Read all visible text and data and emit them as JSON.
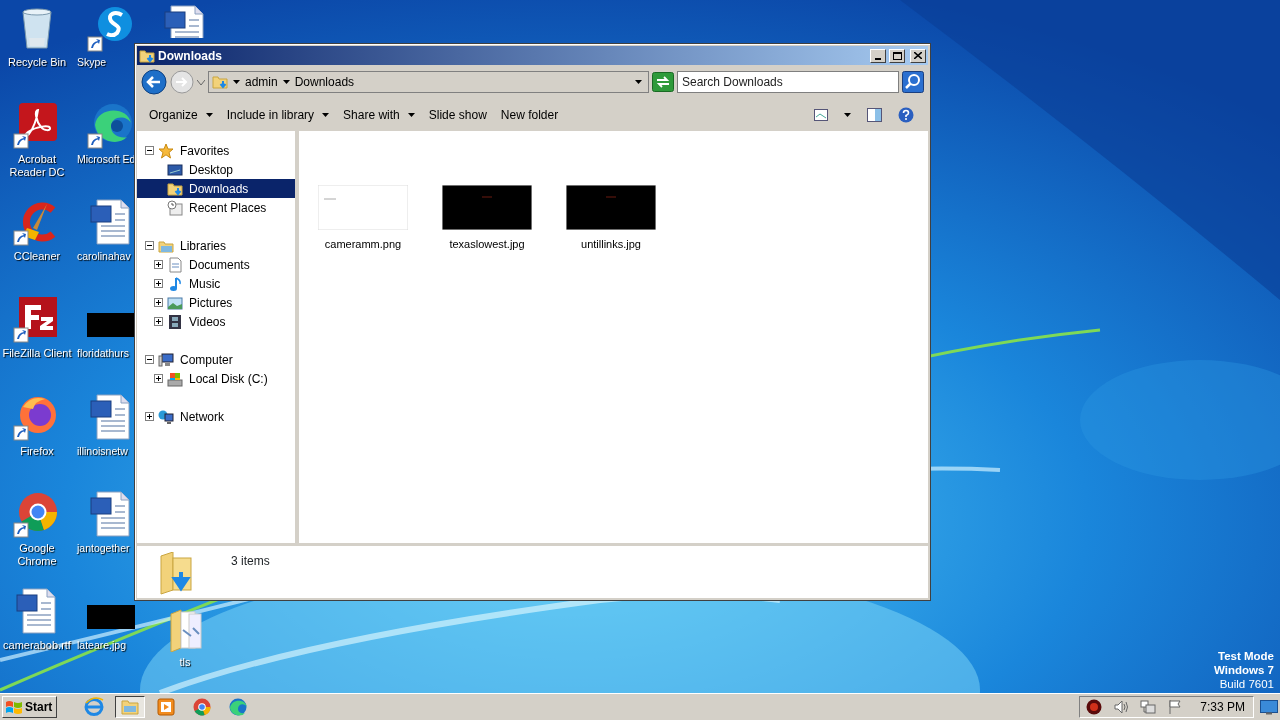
{
  "desktop": {
    "columns": [
      [
        {
          "label": "Recycle Bin",
          "kind": "recycle-bin"
        },
        {
          "label": "Acrobat Reader DC",
          "kind": "pdf-reader",
          "shortcut": true
        },
        {
          "label": "CCleaner",
          "kind": "cleaner",
          "shortcut": true
        },
        {
          "label": "FileZilla Client",
          "kind": "ftp-client",
          "shortcut": true
        },
        {
          "label": "Firefox",
          "kind": "firefox",
          "shortcut": true
        },
        {
          "label": "Google Chrome",
          "kind": "chrome",
          "shortcut": true
        },
        {
          "label": "camerabob.rtf",
          "kind": "word-document"
        }
      ],
      [
        {
          "label": "Skype",
          "kind": "messenger",
          "shortcut": true
        },
        {
          "label": "Microsoft Ed",
          "kind": "edge",
          "shortcut": true
        },
        {
          "label": "carolinahav",
          "kind": "word-document"
        },
        {
          "label": "floridathurs",
          "kind": "dark-image"
        },
        {
          "label": "illinoisnetw",
          "kind": "word-document"
        },
        {
          "label": "jantogether",
          "kind": "word-document"
        },
        {
          "label": "lateare.jpg",
          "kind": "dark-image"
        }
      ],
      [
        {
          "kind": "word-document"
        },
        {
          "label": "tls",
          "kind": "folder"
        }
      ]
    ]
  },
  "window": {
    "title": "Downloads",
    "address": {
      "crumbs": [
        "admin",
        "Downloads"
      ]
    },
    "search": {
      "placeholder": "Search Downloads"
    },
    "toolbar": [
      {
        "label": "Organize",
        "menu": true
      },
      {
        "label": "Include in library",
        "menu": true
      },
      {
        "label": "Share with",
        "menu": true
      },
      {
        "label": "Slide show"
      },
      {
        "label": "New folder"
      }
    ],
    "nav": [
      {
        "label": "Favorites",
        "kind": "favorites",
        "expanded": true,
        "selected": false,
        "children": [
          {
            "label": "Desktop",
            "kind": "desktop",
            "selected": false
          },
          {
            "label": "Downloads",
            "kind": "downloads",
            "selected": true
          },
          {
            "label": "Recent Places",
            "kind": "recent",
            "selected": false
          }
        ]
      },
      {
        "label": "Libraries",
        "kind": "libraries",
        "expanded": true,
        "selected": false,
        "children": [
          {
            "label": "Documents",
            "kind": "documents",
            "expanded": false,
            "selected": false
          },
          {
            "label": "Music",
            "kind": "music",
            "expanded": false,
            "selected": false
          },
          {
            "label": "Pictures",
            "kind": "pictures",
            "expanded": false,
            "selected": false
          },
          {
            "label": "Videos",
            "kind": "videos",
            "expanded": false,
            "selected": false
          }
        ]
      },
      {
        "label": "Computer",
        "kind": "computer",
        "expanded": true,
        "selected": false,
        "children": [
          {
            "label": "Local Disk (C:)",
            "kind": "disk",
            "expanded": false,
            "selected": false
          }
        ]
      },
      {
        "label": "Network",
        "kind": "network",
        "expanded": false,
        "selected": false
      }
    ],
    "files": [
      {
        "name": "cameramm.png",
        "kind": "light-image"
      },
      {
        "name": "texaslowest.jpg",
        "kind": "dark-image"
      },
      {
        "name": "untillinks.jpg",
        "kind": "dark-image"
      }
    ],
    "status": "3 items"
  },
  "system_notice": [
    {
      "text": "Test Mode",
      "bold": true
    },
    {
      "text": "Windows 7",
      "bold": true
    },
    {
      "text": "Build 7601",
      "bold": false
    }
  ],
  "taskbar": {
    "start": "Start",
    "apps": [
      {
        "kind": "ie",
        "active": false
      },
      {
        "kind": "explorer",
        "active": true
      },
      {
        "kind": "media",
        "active": false
      },
      {
        "kind": "chrome",
        "active": false
      },
      {
        "kind": "edge",
        "active": false
      }
    ],
    "tray": [
      {
        "kind": "alert"
      },
      {
        "kind": "volume"
      },
      {
        "kind": "network"
      },
      {
        "kind": "flag"
      }
    ],
    "clock": "7:33 PM"
  }
}
